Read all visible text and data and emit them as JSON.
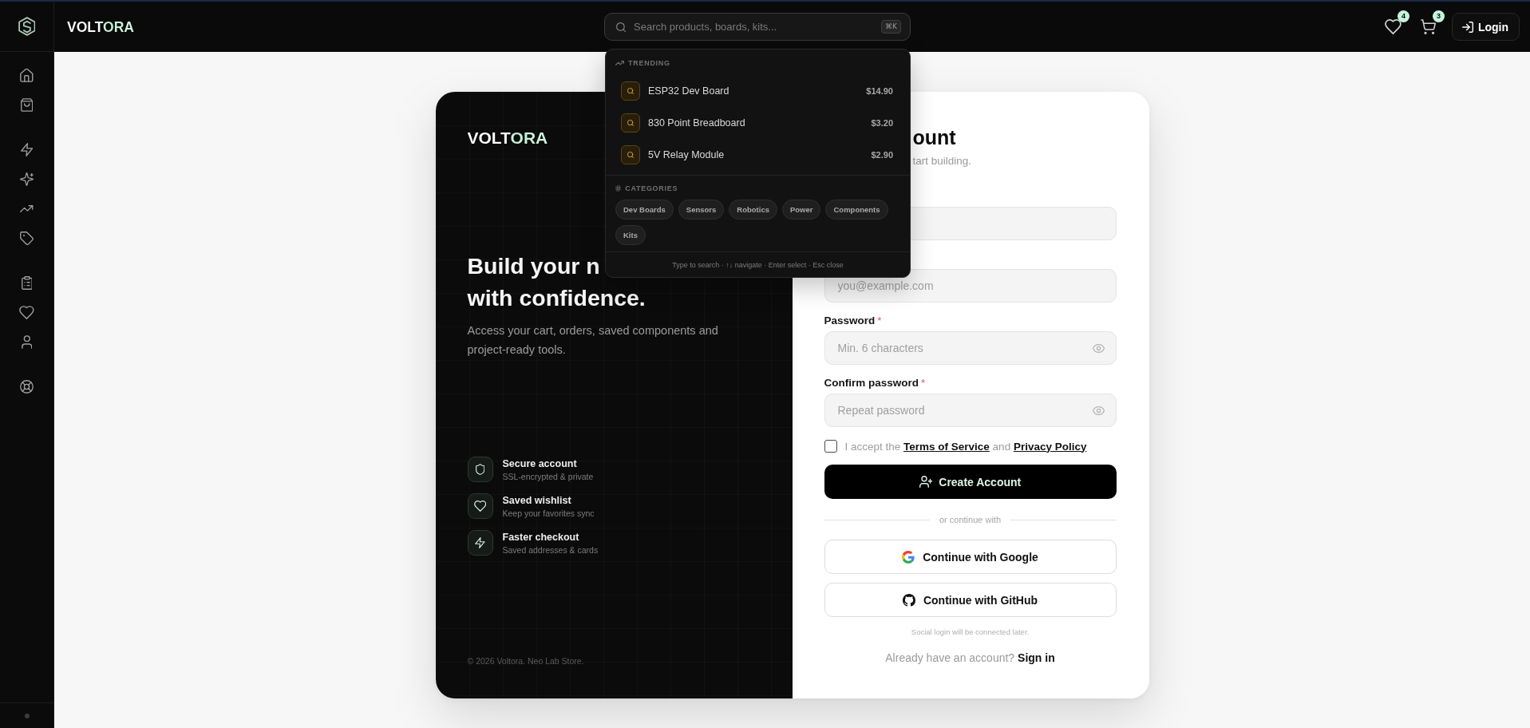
{
  "header": {
    "logo": "VOLTORA",
    "search": {
      "placeholder": "Search products, boards, kits...",
      "shortcut": "⌘K"
    },
    "wishlist_count": "4",
    "cart_count": "3",
    "login": "Login"
  },
  "search_dropdown": {
    "trending_label": "TRENDING",
    "trending": [
      {
        "name": "ESP32 Dev Board",
        "price": "$14.90"
      },
      {
        "name": "830 Point Breadboard",
        "price": "$3.20"
      },
      {
        "name": "5V Relay Module",
        "price": "$2.90"
      }
    ],
    "categories_label": "CATEGORIES",
    "categories": [
      "Dev Boards",
      "Sensors",
      "Robotics",
      "Power",
      "Components",
      "Kits"
    ],
    "hint": "Type to search · ↑↓ navigate · Enter select · Esc close"
  },
  "brand_panel": {
    "logo": "VOLTORA",
    "headline": [
      "Build your n",
      "with confidence."
    ],
    "description": "Access your cart, orders, saved components and project-ready tools.",
    "features": [
      {
        "title": "Secure account",
        "subtitle": "SSL-encrypted & private"
      },
      {
        "title": "Saved wishlist",
        "subtitle": "Keep your favorites sync"
      },
      {
        "title": "Faster checkout",
        "subtitle": "Saved addresses & cards"
      }
    ],
    "copyright": "© 2026 Voltora. Neo Lab Store."
  },
  "form": {
    "title": "ount",
    "subtitle": "tart building.",
    "fields": [
      {
        "kind": "text"
      },
      {
        "kind": "email",
        "placeholder": "you@example.com"
      },
      {
        "kind": "password",
        "label": "Password",
        "required_mark": "*",
        "placeholder": "Min. 6 characters"
      },
      {
        "kind": "password",
        "label": "Confirm password",
        "required_mark": "*",
        "placeholder": "Repeat password"
      }
    ],
    "terms": {
      "checked": false,
      "parts": [
        {
          "kind": "text",
          "text": "I accept the "
        },
        {
          "kind": "link",
          "text": "Terms of Service"
        },
        {
          "kind": "text",
          "text": " and "
        },
        {
          "kind": "link",
          "text": "Privacy Policy"
        }
      ]
    },
    "submit": "Create Account",
    "divider": "or continue with",
    "social": [
      {
        "label": "Continue with Google"
      },
      {
        "label": "Continue with GitHub"
      }
    ],
    "social_note": "Social login will be connected later.",
    "signin": {
      "prompt": "Already have an account? ",
      "link": "Sign in"
    }
  }
}
